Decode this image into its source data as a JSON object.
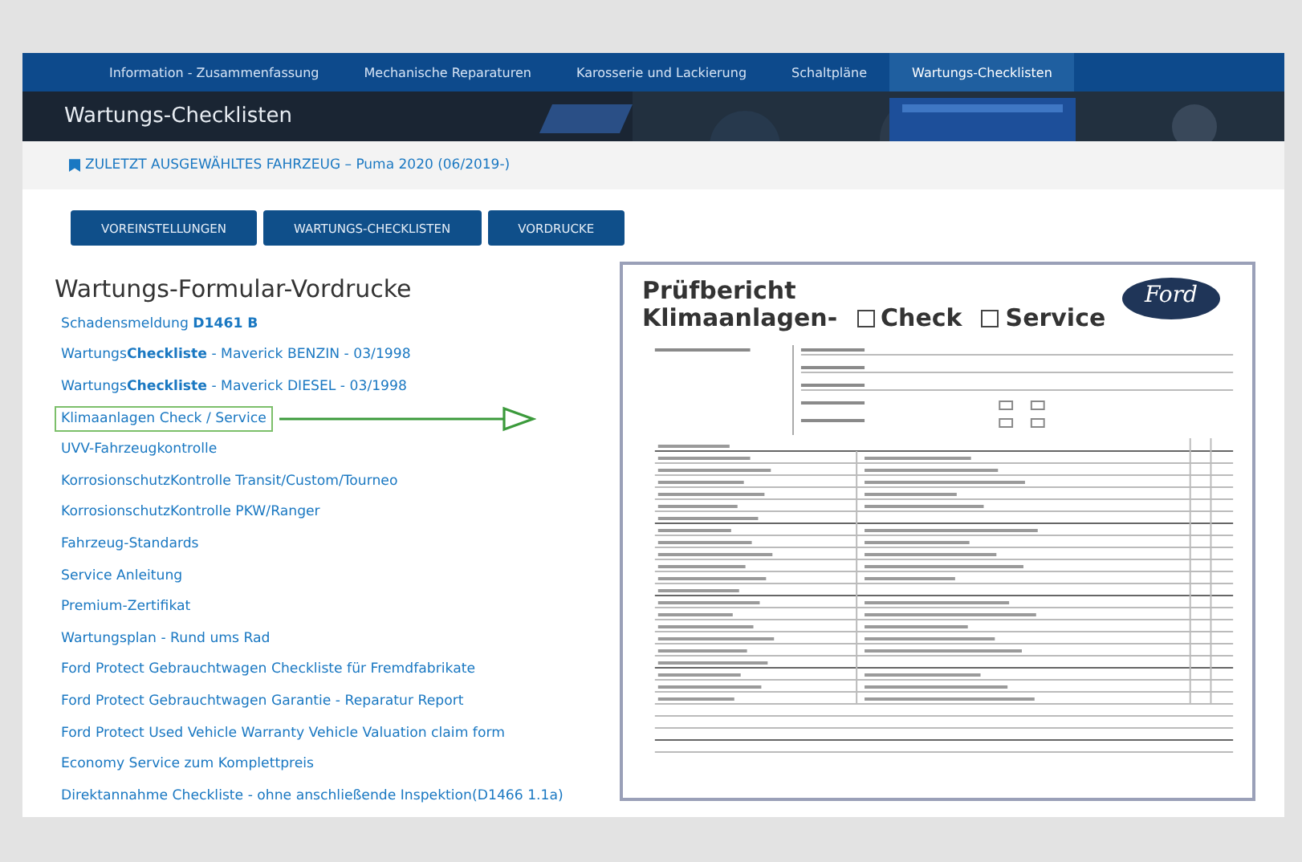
{
  "nav": [
    {
      "label": "Information - Zusammenfassung",
      "selected": false
    },
    {
      "label": "Mechanische Reparaturen",
      "selected": false
    },
    {
      "label": "Karosserie und Lackierung",
      "selected": false
    },
    {
      "label": "Schaltpläne",
      "selected": false
    },
    {
      "label": "Wartungs-Checklisten",
      "selected": true
    }
  ],
  "header": {
    "title": "Wartungs-Checklisten",
    "kind": "picture"
  },
  "breadcrumb": "ZULETZT AUSGEWÄHLTES FAHRZEUG – Puma 2020 (06/2019-)",
  "buttons": [
    "VOREINSTELLUNGEN",
    "WARTUNGS-CHECKLISTEN",
    "VORDRUCKE"
  ],
  "section": {
    "heading": "Wartungs-Formular-Vordrucke",
    "links": [
      {
        "text": "Schadensmeldung **D1461 B**",
        "highlighted": false
      },
      {
        "text": "Wartungs**Checkliste** - Maverick BENZIN - 03/1998",
        "highlighted": false
      },
      {
        "text": "Wartungs**Checkliste** - Maverick DIESEL - 03/1998",
        "highlighted": false
      },
      {
        "text": "Klimaanlagen Check / Service",
        "highlighted": true
      },
      {
        "text": "UVV-Fahrzeugkontrolle",
        "highlighted": false
      },
      {
        "text": "KorrosionschutzKontrolle Transit/Custom/Tourneo",
        "highlighted": false
      },
      {
        "text": "KorrosionschutzKontrolle PKW/Ranger",
        "highlighted": false
      },
      {
        "text": "Fahrzeug-Standards",
        "highlighted": false
      },
      {
        "text": "Service Anleitung",
        "highlighted": false
      },
      {
        "text": "Premium-Zertifikat",
        "highlighted": false
      },
      {
        "text": "Wartungsplan - Rund ums Rad",
        "highlighted": false
      },
      {
        "text": "Ford Protect Gebrauchtwagen Checkliste für Fremdfabrikate",
        "highlighted": false
      },
      {
        "text": "Ford Protect Gebrauchtwagen Garantie - Reparatur Report",
        "highlighted": false
      },
      {
        "text": "Ford Protect Used Vehicle Warranty Vehicle Valuation claim form",
        "highlighted": false
      },
      {
        "text": "Economy Service zum Komplettpreis",
        "highlighted": false
      },
      {
        "text": "Direktannahme Checkliste - ohne anschließende Inspektion(D1466 1.1a)",
        "highlighted": false
      }
    ]
  },
  "preview": {
    "title_line1": "Prüfbericht",
    "title_line2": "Klimaanlagen-",
    "options": [
      "Check",
      "Service"
    ],
    "logo": "Ford"
  }
}
